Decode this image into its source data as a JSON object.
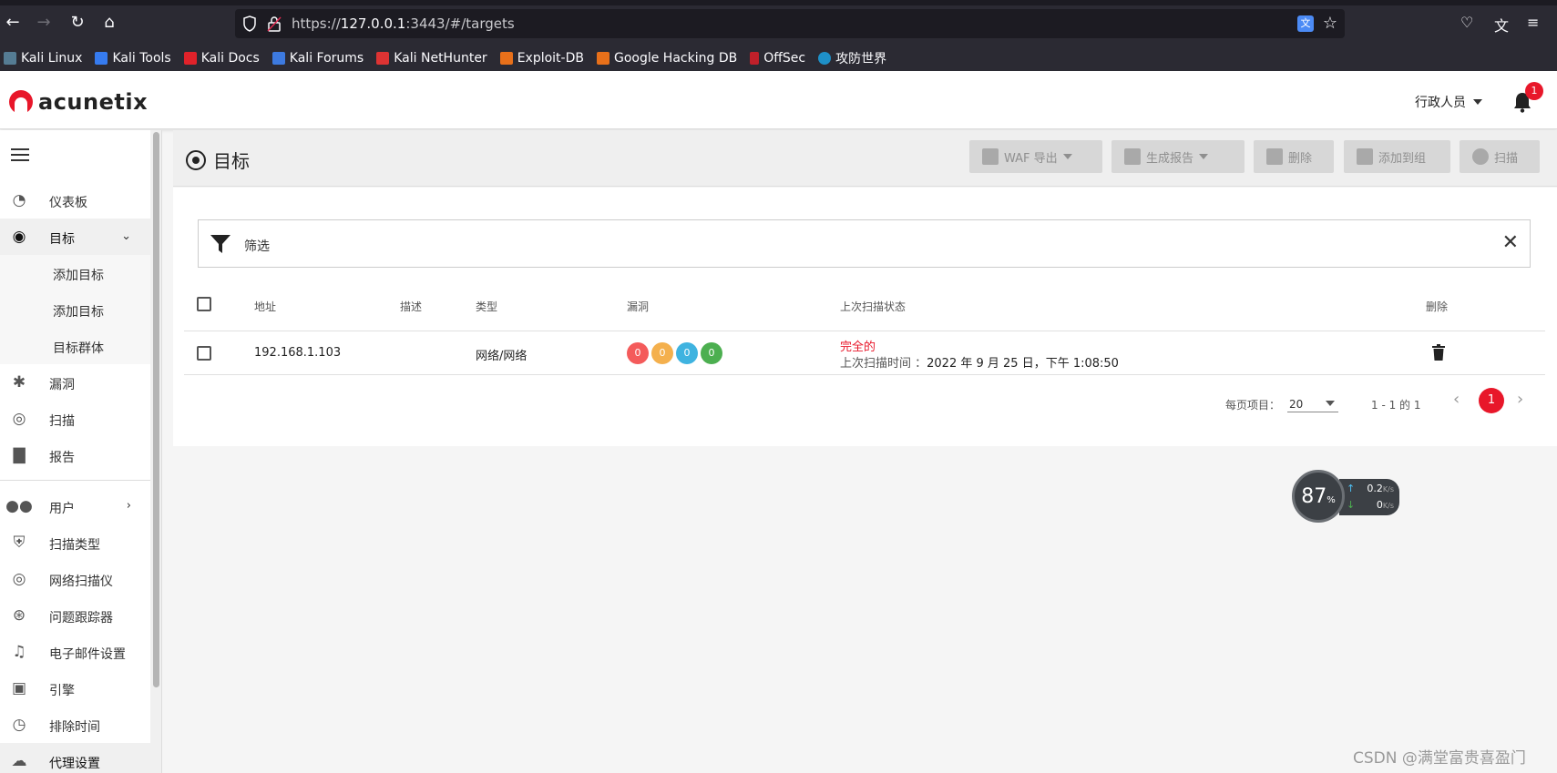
{
  "browser": {
    "url_prefix": "https://",
    "url_host": "127.0.0.1",
    "url_rest": ":3443/#/targets",
    "bookmarks": [
      "Kali Linux",
      "Kali Tools",
      "Kali Docs",
      "Kali Forums",
      "Kali NetHunter",
      "Exploit-DB",
      "Google Hacking DB",
      "OffSec",
      "攻防世界"
    ]
  },
  "app": {
    "logo_text": "acunetix",
    "user": "行政人员",
    "notification_count": "1"
  },
  "sidebar": {
    "items": [
      {
        "label": "仪表板",
        "icon": "dashboard-icon"
      },
      {
        "label": "目标",
        "icon": "target-icon"
      },
      {
        "label": "添加目标"
      },
      {
        "label": "添加目标"
      },
      {
        "label": "目标群体"
      },
      {
        "label": "漏洞",
        "icon": "bug-icon"
      },
      {
        "label": "扫描",
        "icon": "scan-icon"
      },
      {
        "label": "报告",
        "icon": "report-icon"
      },
      {
        "label": "用户",
        "icon": "users-icon"
      },
      {
        "label": "扫描类型",
        "icon": "shield-icon"
      },
      {
        "label": "网络扫描仪",
        "icon": "network-scanner-icon"
      },
      {
        "label": "问题跟踪器",
        "icon": "issue-tracker-icon"
      },
      {
        "label": "电子邮件设置",
        "icon": "bell-icon"
      },
      {
        "label": "引擎",
        "icon": "cpu-icon"
      },
      {
        "label": "排除时间",
        "icon": "clock-icon"
      },
      {
        "label": "代理设置",
        "icon": "cloud-icon"
      }
    ]
  },
  "page": {
    "title": "目标",
    "toolbar": {
      "waf_export": "WAF 导出",
      "generate_report": "生成报告",
      "delete": "删除",
      "add_to_group": "添加到组",
      "scan": "扫描"
    },
    "filter_label": "筛选",
    "columns": [
      "地址",
      "描述",
      "类型",
      "漏洞",
      "上次扫描状态",
      "删除"
    ],
    "rows": [
      {
        "address": "192.168.1.103",
        "description": "",
        "type": "网络/网络",
        "vulns": [
          "0",
          "0",
          "0",
          "0"
        ],
        "status": "完全的",
        "last_scan_label": "上次扫描时间 ：",
        "last_scan_time": "2022 年 9 月 25 日，下午 1:08:50"
      }
    ],
    "pagination": {
      "per_page_label": "每页项目：",
      "per_page_value": "20",
      "range": "1 - 1 的 1",
      "current_page": "1"
    }
  },
  "speed_widget": {
    "percent": "87",
    "percent_unit": "%",
    "upload": "0.2",
    "download": "0",
    "unit": "K/s"
  },
  "watermark": "CSDN @满堂富贵喜盈门",
  "colors": {
    "accent": "#e8172a",
    "vuln_high": "#f45b5b",
    "vuln_medium": "#f4b04d",
    "vuln_low": "#3fb3e0",
    "vuln_info": "#4caf50"
  }
}
